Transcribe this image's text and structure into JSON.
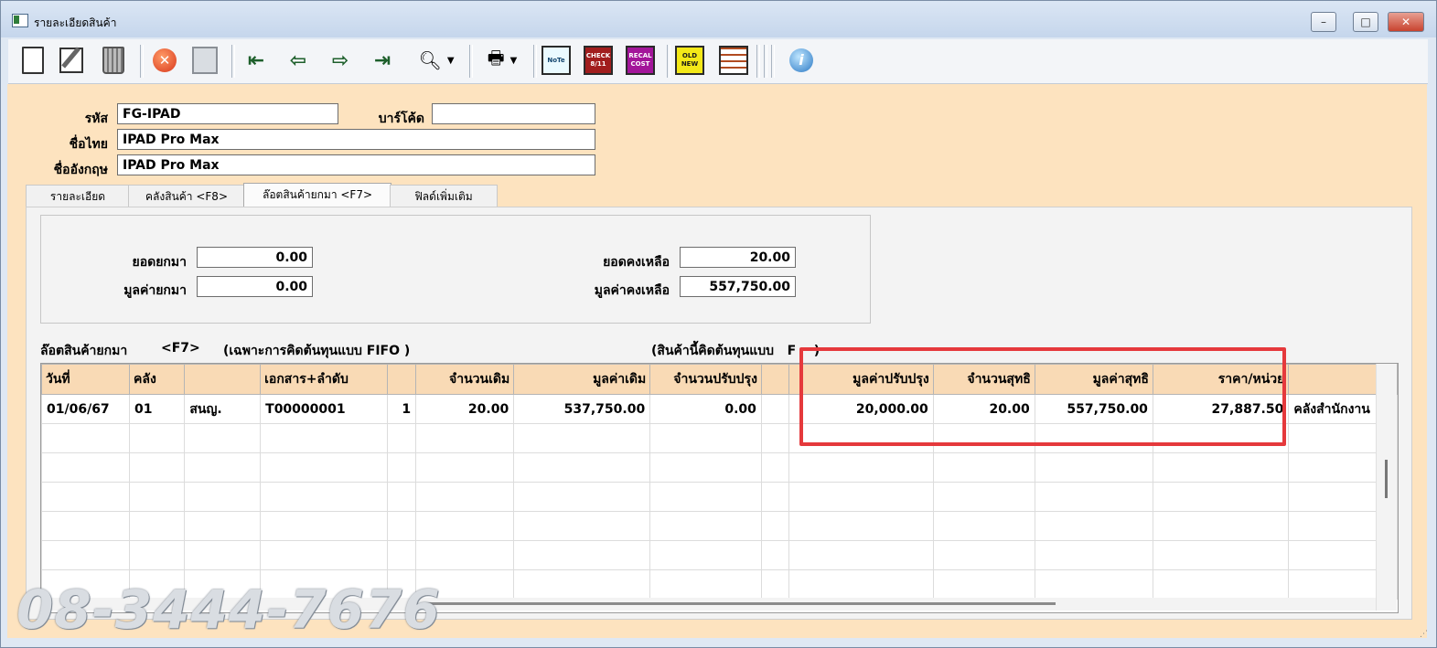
{
  "window": {
    "title": "รายละเอียดสินค้า"
  },
  "toolbar": {
    "icons": [
      "new-doc-icon",
      "edit-icon",
      "trash-icon",
      "stop-icon",
      "save-icon",
      "first-icon",
      "prev-icon",
      "next-icon",
      "last-icon",
      "search-icon",
      "print-icon",
      "note-icon",
      "check-icon",
      "recal-cost-icon",
      "old-new-icon",
      "grid-icon",
      "info-icon"
    ],
    "note_label": "NoTe",
    "check_top": "CHECK",
    "check_bottom": "8/11",
    "recal_top": "RECAL",
    "recal_bottom": "COST",
    "oldnew_top": "OLD",
    "oldnew_bottom": "NEW"
  },
  "form": {
    "code_label": "รหัส",
    "code_value": "FG-IPAD",
    "barcode_label": "บาร์โค้ด",
    "barcode_value": "",
    "thai_name_label": "ชื่อไทย",
    "thai_name_value": "IPAD Pro Max",
    "eng_name_label": "ชื่ออังกฤษ",
    "eng_name_value": "IPAD Pro Max"
  },
  "tabs": [
    {
      "label": "รายละเอียด",
      "active": false
    },
    {
      "label": "คลังสินค้า <F8>",
      "active": false
    },
    {
      "label": "ล๊อตสินค้ายกมา <F7>",
      "active": true
    },
    {
      "label": "ฟิลด์เพิ่มเติม",
      "active": false
    }
  ],
  "summary": {
    "bf_qty_label": "ยอดยกมา",
    "bf_qty_value": "0.00",
    "bf_value_label": "มูลค่ายกมา",
    "bf_value_value": "0.00",
    "bal_qty_label": "ยอดคงเหลือ",
    "bal_qty_value": "20.00",
    "bal_value_label": "มูลค่าคงเหลือ",
    "bal_value_value": "557,750.00"
  },
  "lot_section": {
    "title": "ล๊อตสินค้ายกมา",
    "hotkey": "<F7>",
    "note": "(เฉพาะการคิดต้นทุนแบบ FIFO )",
    "cost_method_note": "(สินค้านี้คิดต้นทุนแบบ   F    )"
  },
  "grid": {
    "headers": [
      "วันที่",
      "คลัง",
      "",
      "เอกสาร+ลำดับ",
      "",
      "จำนวนเดิม",
      "มูลค่าเดิม",
      "จำนวนปรับปรุง",
      "",
      "มูลค่าปรับปรุง",
      "จำนวนสุทธิ",
      "มูลค่าสุทธิ",
      "ราคา/หน่วย",
      ""
    ],
    "rows": [
      [
        "01/06/67",
        "01",
        "สนญ.",
        "T00000001",
        "1",
        "20.00",
        "537,750.00",
        "0.00",
        "",
        "20,000.00",
        "20.00",
        "557,750.00",
        "27,887.50",
        "คลังสำนักงาน"
      ],
      [
        "",
        "",
        "",
        "",
        "",
        "",
        "",
        "",
        "",
        "",
        "",
        "",
        "",
        ""
      ],
      [
        "",
        "",
        "",
        "",
        "",
        "",
        "",
        "",
        "",
        "",
        "",
        "",
        "",
        ""
      ],
      [
        "",
        "",
        "",
        "",
        "",
        "",
        "",
        "",
        "",
        "",
        "",
        "",
        "",
        ""
      ],
      [
        "",
        "",
        "",
        "",
        "",
        "",
        "",
        "",
        "",
        "",
        "",
        "",
        "",
        ""
      ],
      [
        "",
        "",
        "",
        "",
        "",
        "",
        "",
        "",
        "",
        "",
        "",
        "",
        "",
        ""
      ],
      [
        "",
        "",
        "",
        "",
        "",
        "",
        "",
        "",
        "",
        "",
        "",
        "",
        "",
        ""
      ]
    ]
  },
  "watermark": "08-3444-7676",
  "colors": {
    "highlight": "#e5393c",
    "form_bg": "#fde3bf",
    "header_bg": "#f9dab5"
  }
}
